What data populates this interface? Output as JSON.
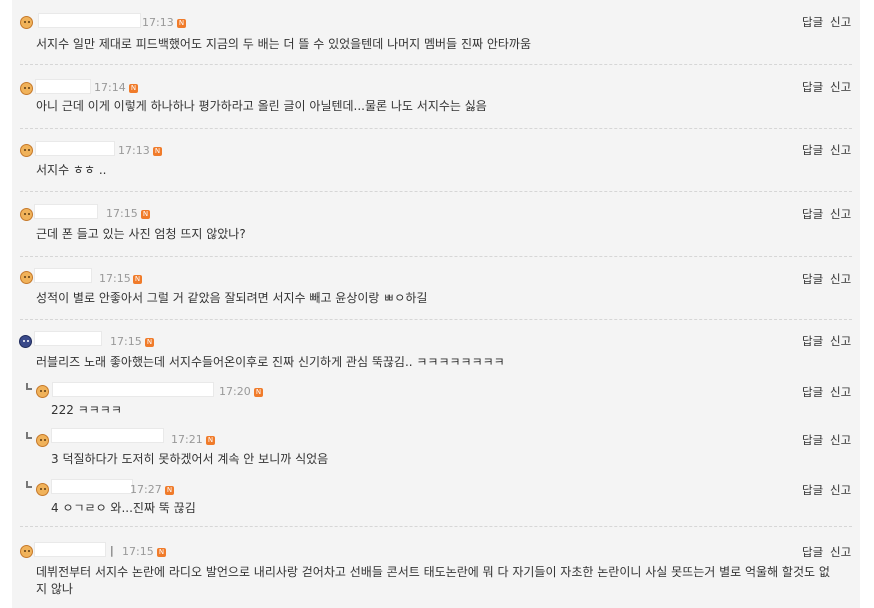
{
  "actions": {
    "reply": "답글",
    "report": "신고"
  },
  "badge": "N",
  "comments": [
    {
      "time": "17:13",
      "text": "서지수 일만 제대로 피드백했어도 지금의 두 배는 더 뜰 수 있었을텐데 나머지 멤버들 진짜 안타까움",
      "avatar": "smile-icon"
    },
    {
      "time": "17:14",
      "text": "아니 근데 이게 이렇게 하나하나 평가하라고 올린 글이 아닐텐데...물론 나도 서지수는 싫음",
      "avatar": "boy-icon"
    },
    {
      "time": "17:13",
      "text": "서지수 ㅎㅎ ..",
      "avatar": "boy-icon"
    },
    {
      "time": "17:15",
      "text": "근데 폰 들고 있는 사진 엄청 뜨지 않았나?",
      "avatar": "boy-icon"
    },
    {
      "time": "17:15",
      "text": "성적이 별로 안좋아서 그럴 거 같았음 잘되려면 서지수 빼고 윤상이랑 ㅃㅇ하길",
      "avatar": "boy-icon"
    },
    {
      "time": "17:15",
      "text": "러블리즈 노래 좋아했는데 서지수들어온이후로 진짜 신기하게 관심 뚝끊김.. ㅋㅋㅋㅋㅋㅋㅋㅋ",
      "avatar": "police-icon"
    },
    {
      "time": "17:20",
      "text": "222 ㅋㅋㅋㅋ",
      "avatar": "boy-icon",
      "reply": true
    },
    {
      "time": "17:21",
      "text": "3 덕질하다가 도저히 못하겠어서 계속 안 보니까 식었음",
      "avatar": "boy-icon",
      "reply": true
    },
    {
      "time": "17:27",
      "text": "4 ㅇㄱㄹㅇ 와...진짜 뚝 끊김",
      "avatar": "smile-icon",
      "reply": true
    },
    {
      "time": "17:15",
      "text": "데뷔전부터 서지수 논란에 라디오 발언으로 내리사랑 걷어차고 선배들 콘서트 태도논란에 뭐 다 자기들이 자초한 논란이니 사실 못뜨는거 별로 억울해 할것도 없지 않나",
      "avatar": "boy-icon",
      "name_sep": "|"
    }
  ]
}
